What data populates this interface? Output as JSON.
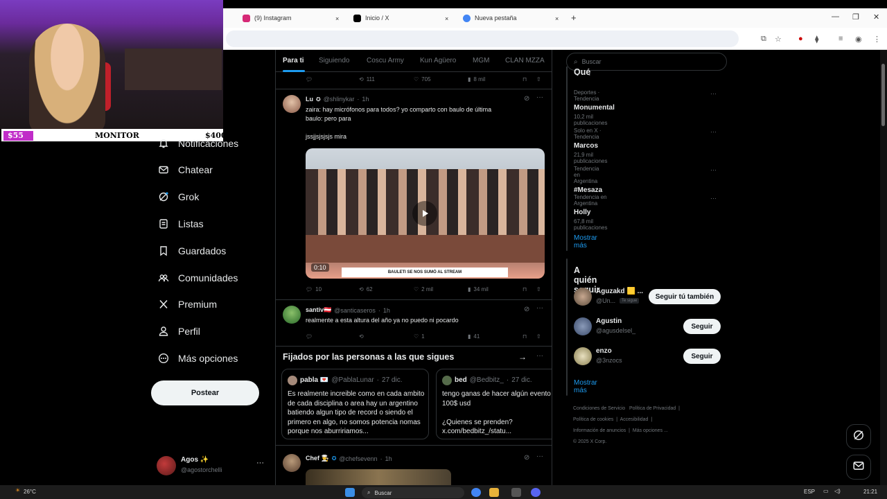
{
  "browser": {
    "tabs": [
      {
        "title": "(9) Instagram",
        "color": "#d62976"
      },
      {
        "title": "Inicio / X",
        "color": "#000000"
      },
      {
        "title": "Nueva pestaña",
        "color": "#4285f4"
      }
    ],
    "new_tab": "+",
    "close": "×"
  },
  "overlay": {
    "goal_left": "$55",
    "goal_label": "MONITOR",
    "goal_right": "$400",
    "goal_progress": 0.1375
  },
  "nav": {
    "items": [
      {
        "label": "Notificaciones",
        "icon": "bell-icon"
      },
      {
        "label": "Chatear",
        "icon": "mail-icon"
      },
      {
        "label": "Grok",
        "icon": "grok-icon"
      },
      {
        "label": "Listas",
        "icon": "list-icon"
      },
      {
        "label": "Guardados",
        "icon": "bookmark-icon"
      },
      {
        "label": "Comunidades",
        "icon": "communities-icon"
      },
      {
        "label": "Premium",
        "icon": "x-logo-icon"
      },
      {
        "label": "Perfil",
        "icon": "person-icon"
      },
      {
        "label": "Más opciones",
        "icon": "more-circle-icon"
      }
    ],
    "post_button": "Postear",
    "profile": {
      "name": "Agos ✨",
      "handle": "@agostorchelli",
      "more": "···"
    }
  },
  "feed": {
    "tabs": [
      "Para ti",
      "Siguiendo",
      "Coscu Army",
      "Kun Agüero",
      "MGM",
      "CLAN MZZA"
    ],
    "top_actions": {
      "reposts": "111",
      "likes": "705",
      "views": "8 mil"
    },
    "tweets": [
      {
        "name": "Lu",
        "handle": "@shlinykar",
        "time": "1h",
        "text1": "zaira: hay micrófonos para todos? yo comparto con baulo de última",
        "text2": "baulo: pero para",
        "text3": "jssjjsjsjsjs mira",
        "video_time": "0:10",
        "video_banner": "BAULETI SE NOS SUMÓ AL STREAM",
        "replies": "10",
        "reposts": "62",
        "likes": "2 mil",
        "views": "34 mil"
      },
      {
        "name": "santiv🇦🇹",
        "handle": "@santicaseros",
        "time": "1h",
        "text1": "realmente a esta altura del año ya no puedo ni pocardo",
        "replies": "",
        "reposts": "",
        "likes": "1",
        "views": "41"
      }
    ],
    "pinned": {
      "title": "Fijados por las personas a las que sigues",
      "cards": [
        {
          "name": "pabla 💌",
          "handle": "@PablaLunar",
          "date": "27 dic.",
          "text": "Es realmente increible como en cada ambito de cada disciplina o area hay un argentino batiendo algun tipo de record o siendo el primero en algo, no somos potencia nomas porque nos aburririamos..."
        },
        {
          "name": "bed",
          "handle": "@Bedbitz_",
          "date": "27 dic.",
          "text": "tengo ganas de hacer algún evento 100$ usd\n\n¿Quienes se prenden? x.com/bedbitz_/statu..."
        }
      ]
    },
    "last_tweet": {
      "name": "Chef 👨‍🍳",
      "handle": "@chefsevenn",
      "time": "1h"
    }
  },
  "sidebar": {
    "search_placeholder": "Buscar",
    "trends_title": "Qué está pasando",
    "trends": [
      {
        "category": "Deportes · Tendencia",
        "name": "Monumental",
        "count": "10,2 mil publicaciones"
      },
      {
        "category": "Solo en X · Tendencia",
        "name": "Marcos",
        "count": "21,9 mil publicaciones"
      },
      {
        "category": "Tendencia en Argentina",
        "name": "#Mesaza",
        "count": ""
      },
      {
        "category": "Tendencia en Argentina",
        "name": "Holly",
        "count": "67,8 mil publicaciones"
      }
    ],
    "show_more": "Mostrar más",
    "who_to_follow_title": "A quién seguir",
    "follow": [
      {
        "name": "Aguzakd 🟨 ...",
        "handle": "@Un...",
        "badge": "Te sigue",
        "button": "Seguir tú también"
      },
      {
        "name": "Agustin",
        "handle": "@agusdelsel_",
        "button": "Seguir"
      },
      {
        "name": "enzo",
        "handle": "@3nzocs",
        "button": "Seguir"
      }
    ],
    "footer": [
      "Condiciones de Servicio",
      "Política de Privacidad",
      "Política de cookies",
      "Accesibilidad",
      "Información de anuncios",
      "Más opciones ...",
      "© 2025 X Corp."
    ]
  },
  "taskbar": {
    "weather": "26°C",
    "search": "Buscar",
    "lang": "ESP",
    "time": "21:21"
  }
}
